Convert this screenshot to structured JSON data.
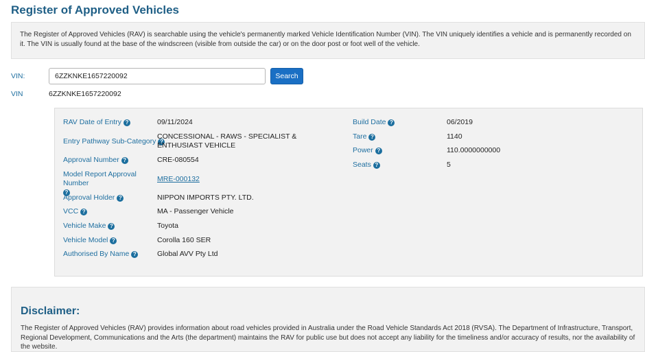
{
  "page": {
    "title": "Register of Approved Vehicles"
  },
  "intro": {
    "text": "The Register of Approved Vehicles (RAV) is searchable using the vehicle's permanently marked Vehicle Identification Number (VIN). The VIN uniquely identifies a vehicle and is permanently recorded on it. The VIN is usually found at the base of the windscreen (visible from outside the car) or on the door post or foot well of the vehicle."
  },
  "search": {
    "label": "VIN:",
    "value": "6ZZKNKE1657220092",
    "button_label": "Search"
  },
  "result": {
    "vin_label": "VIN",
    "vin_value": "6ZZKNKE1657220092"
  },
  "details_left": [
    {
      "label": "RAV Date of Entry",
      "value": "09/11/2024"
    },
    {
      "label": "Entry Pathway Sub-Category",
      "value": "CONCESSIONAL - RAWS - SPECIALIST & ENTHUSIAST VEHICLE"
    },
    {
      "label": "Approval Number",
      "value": "CRE-080554"
    },
    {
      "label": "Model Report Approval Number",
      "value": "MRE-000132"
    },
    {
      "label": "Approval Holder",
      "value": "NIPPON IMPORTS PTY. LTD."
    },
    {
      "label": "VCC",
      "value": "MA - Passenger Vehicle"
    },
    {
      "label": "Vehicle Make",
      "value": "Toyota"
    },
    {
      "label": "Vehicle Model",
      "value": "Corolla 160 SER"
    },
    {
      "label": "Authorised By Name",
      "value": "Global AVV Pty Ltd"
    }
  ],
  "details_right": [
    {
      "label": "Build Date",
      "value": "06/2019"
    },
    {
      "label": "Tare",
      "value": "1140"
    },
    {
      "label": "Power",
      "value": "110.0000000000"
    },
    {
      "label": "Seats",
      "value": "5"
    }
  ],
  "icons": {
    "help": "?"
  },
  "disclaimer": {
    "title": "Disclaimer:",
    "text": "The Register of Approved Vehicles (RAV) provides information about road vehicles provided in Australia under the Road Vehicle Standards Act 2018 (RVSA). The Department of Infrastructure, Transport, Regional Development, Communications and the Arts (the department) maintains the RAV for public use but does not accept any liability for the timeliness and/or accuracy of results, nor the availability of the website."
  },
  "colors": {
    "accent": "#1f5f86",
    "button": "#1a6fc4",
    "panel": "#f2f2f2"
  }
}
